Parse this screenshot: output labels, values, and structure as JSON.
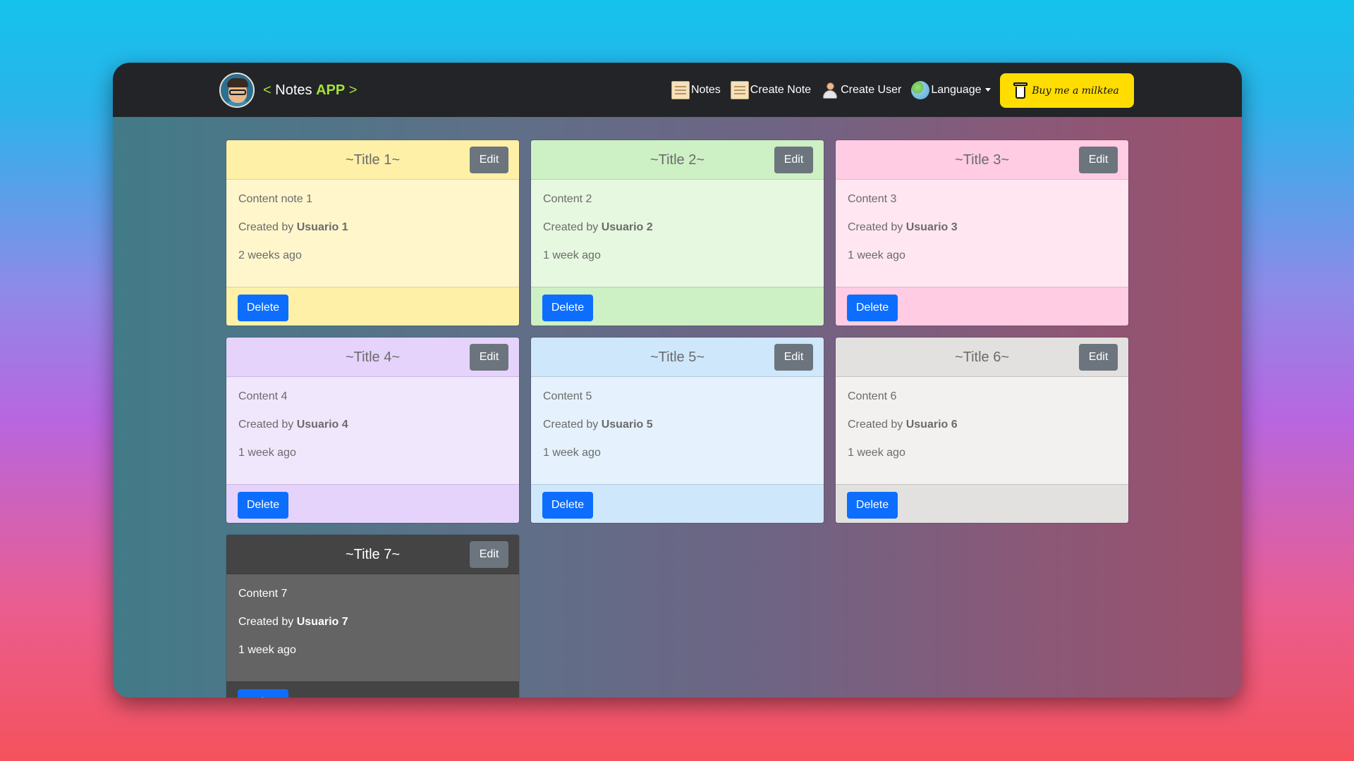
{
  "navbar": {
    "brand_open": "< ",
    "brand_name": "Notes ",
    "brand_app": "APP",
    "brand_close": " >",
    "links": [
      {
        "label": "Notes",
        "icon": "note-icon"
      },
      {
        "label": "Create Note",
        "icon": "create-note-icon"
      },
      {
        "label": "Create User",
        "icon": "user-icon"
      },
      {
        "label": "Language",
        "icon": "globe-icon"
      }
    ],
    "donate_label": "Buy me a milktea"
  },
  "notes": [
    {
      "title": "~Title 1~",
      "content": "Content note 1",
      "created_by_prefix": "Created by ",
      "author": "Usuario 1",
      "time": "2 weeks ago",
      "edit_label": "Edit",
      "delete_label": "Delete",
      "colors": {
        "header": "#fff0a8",
        "body": "#fff6cc",
        "footer": "#fff0a8",
        "text": "#6b6b6b",
        "title": "#6b6b6b"
      }
    },
    {
      "title": "~Title 2~",
      "content": "Content 2",
      "created_by_prefix": "Created by ",
      "author": "Usuario 2",
      "time": "1 week ago",
      "edit_label": "Edit",
      "delete_label": "Delete",
      "colors": {
        "header": "#cdf0c4",
        "body": "#e6f8df",
        "footer": "#cdf0c4",
        "text": "#6b6b6b",
        "title": "#6b6b6b"
      }
    },
    {
      "title": "~Title 3~",
      "content": "Content 3",
      "created_by_prefix": "Created by ",
      "author": "Usuario 3",
      "time": "1 week ago",
      "edit_label": "Edit",
      "delete_label": "Delete",
      "colors": {
        "header": "#ffcce3",
        "body": "#ffe6f0",
        "footer": "#ffcce3",
        "text": "#6b6b6b",
        "title": "#6b6b6b"
      }
    },
    {
      "title": "~Title 4~",
      "content": "Content 4",
      "created_by_prefix": "Created by ",
      "author": "Usuario 4",
      "time": "1 week ago",
      "edit_label": "Edit",
      "delete_label": "Delete",
      "colors": {
        "header": "#e5d3fc",
        "body": "#f1e7fd",
        "footer": "#e5d3fc",
        "text": "#6b6b6b",
        "title": "#6b6b6b"
      }
    },
    {
      "title": "~Title 5~",
      "content": "Content 5",
      "created_by_prefix": "Created by ",
      "author": "Usuario 5",
      "time": "1 week ago",
      "edit_label": "Edit",
      "delete_label": "Delete",
      "colors": {
        "header": "#cfe7fb",
        "body": "#e5f2fd",
        "footer": "#cfe7fb",
        "text": "#6b6b6b",
        "title": "#6b6b6b"
      }
    },
    {
      "title": "~Title 6~",
      "content": "Content 6",
      "created_by_prefix": "Created by ",
      "author": "Usuario 6",
      "time": "1 week ago",
      "edit_label": "Edit",
      "delete_label": "Delete",
      "colors": {
        "header": "#e2e1df",
        "body": "#f2f1ef",
        "footer": "#e2e1df",
        "text": "#6b6b6b",
        "title": "#6b6b6b"
      }
    },
    {
      "title": "~Title 7~",
      "content": "Content 7",
      "created_by_prefix": "Created by ",
      "author": "Usuario 7",
      "time": "1 week ago",
      "edit_label": "Edit",
      "delete_label": "Delete",
      "colors": {
        "header": "#444444",
        "body": "#646464",
        "footer": "#444444",
        "text": "#ffffff",
        "title": "#ffffff"
      }
    }
  ]
}
